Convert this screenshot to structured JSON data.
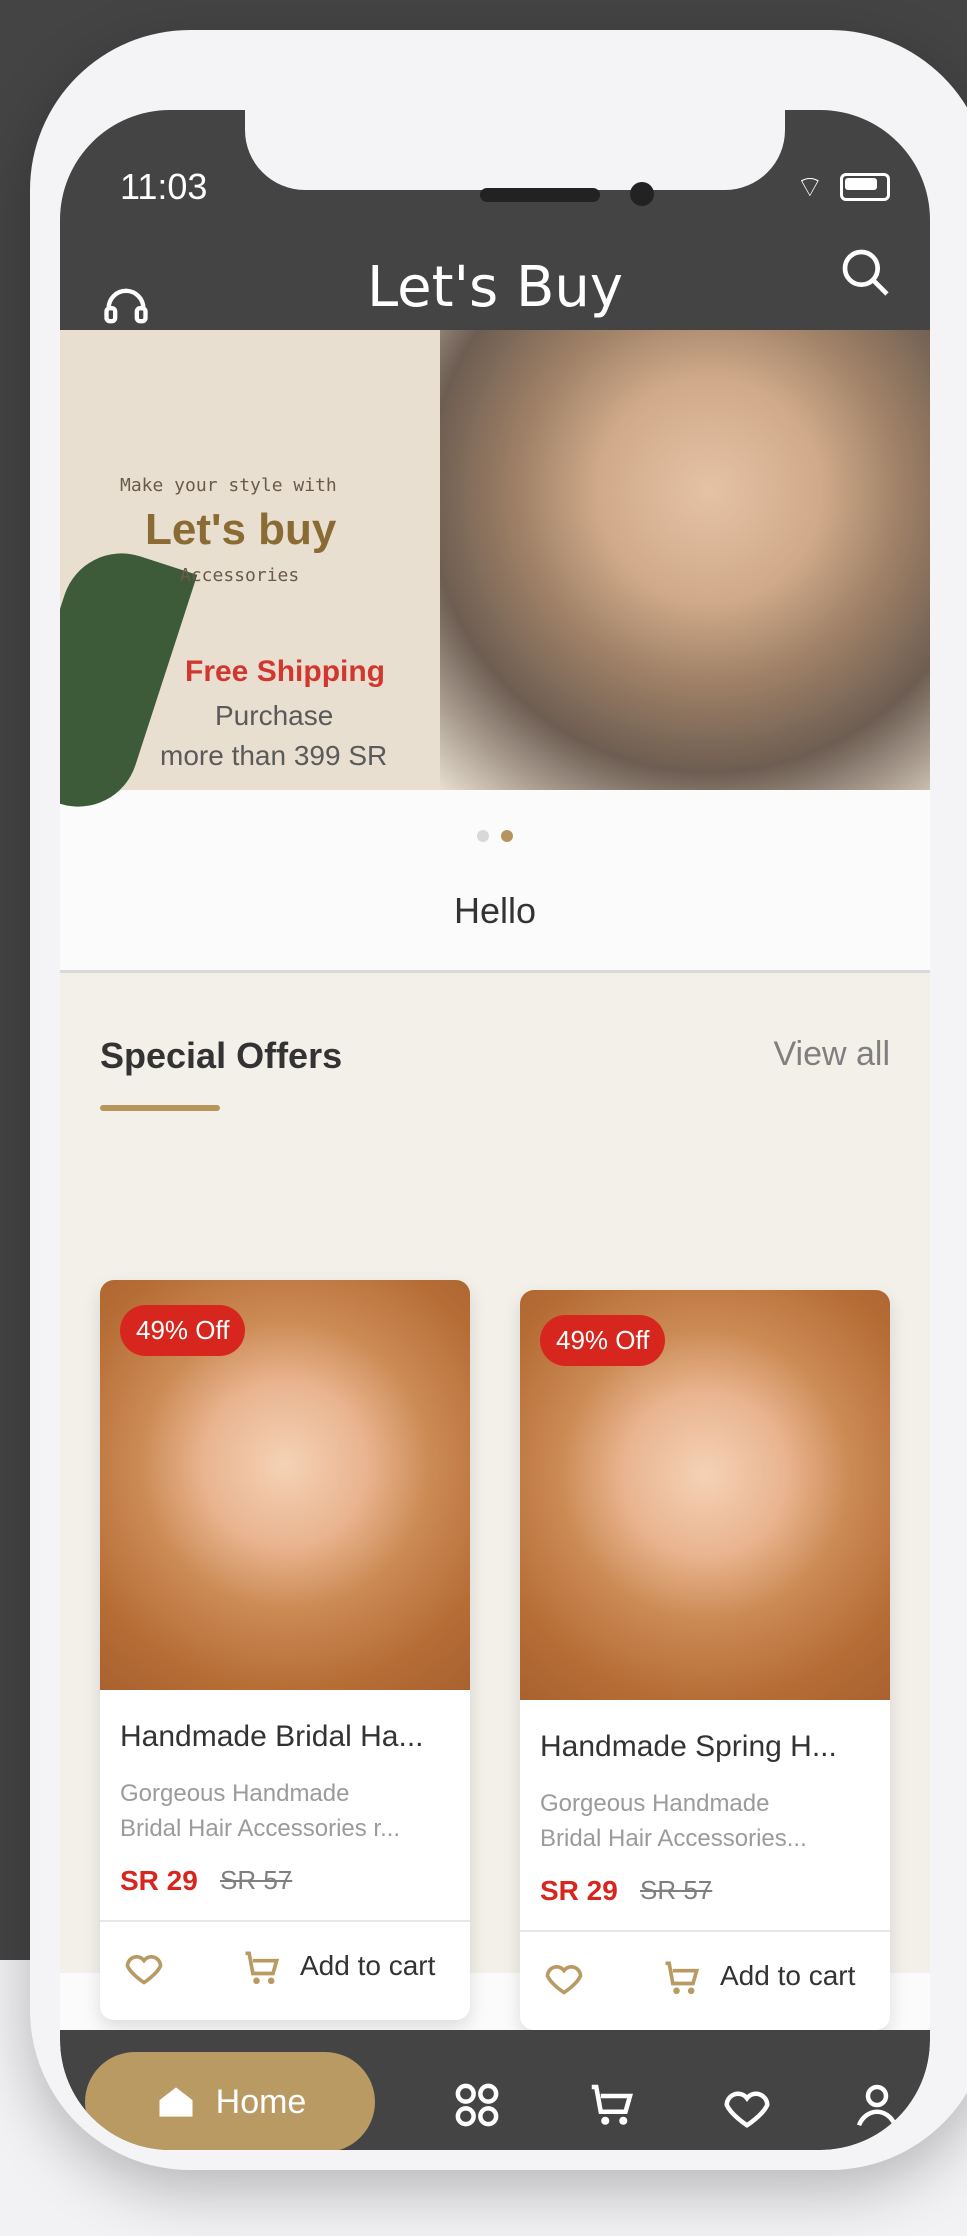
{
  "status_bar": {
    "time": "11:03"
  },
  "header": {
    "title": "Let's Buy"
  },
  "banner": {
    "line1": "Make your style with",
    "line2": "Let's buy",
    "line3": "Accessories",
    "promo_title": "Free Shipping",
    "promo_line1": "Purchase",
    "promo_line2": "more than 399 SR"
  },
  "greeting": "Hello",
  "special_offers": {
    "title": "Special Offers",
    "view_all": "View all",
    "items": [
      {
        "badge": "49% Off",
        "name": "Handmade Bridal Ha...",
        "desc1": "Gorgeous Handmade",
        "desc2": "Bridal Hair Accessories r...",
        "price": "SR 29",
        "old_price": "SR 57",
        "add_to_cart": "Add to cart"
      },
      {
        "badge": "49% Off",
        "name": "Handmade Spring H...",
        "desc1": "Gorgeous Handmade",
        "desc2": "Bridal Hair Accessories...",
        "price": "SR 29",
        "old_price": "SR 57",
        "add_to_cart": "Add to cart"
      }
    ]
  },
  "bottom_nav": {
    "home_label": "Home",
    "icons": [
      "home-icon",
      "categories-icon",
      "cart-icon",
      "wishlist-icon",
      "profile-icon"
    ]
  },
  "colors": {
    "dark": "#444444",
    "accent": "#b89a62",
    "sale_red": "#d6261d",
    "banner_red": "#d2372f"
  }
}
